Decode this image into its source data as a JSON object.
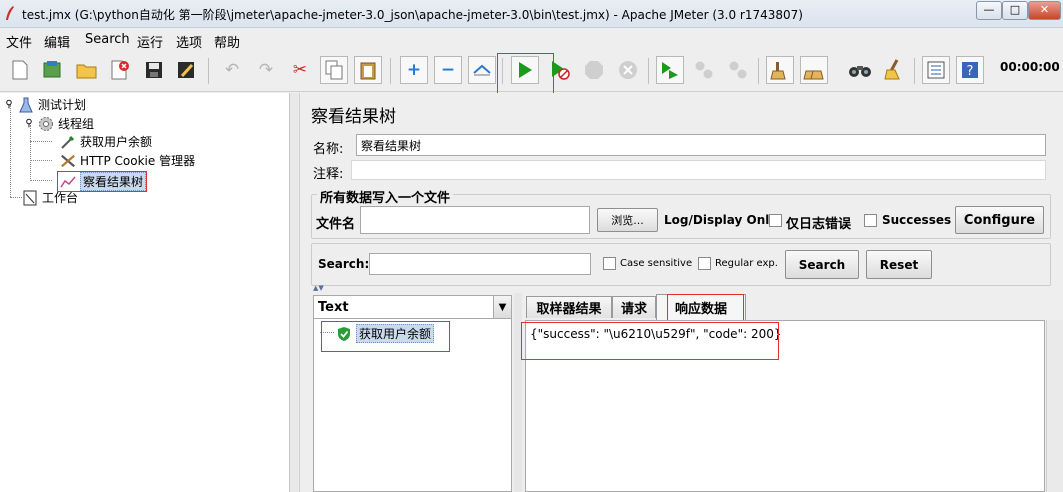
{
  "window": {
    "title": "test.jmx (G:\\python自动化 第一阶段\\jmeter\\apache-jmeter-3.0_json\\apache-jmeter-3.0\\bin\\test.jmx) - Apache JMeter (3.0 r1743807)",
    "min_glyph": "—",
    "max_glyph": "□",
    "close_glyph": "✕"
  },
  "menu": {
    "items": [
      {
        "label": "文件"
      },
      {
        "label": "编辑"
      },
      {
        "label": "Search"
      },
      {
        "label": "运行"
      },
      {
        "label": "选项"
      },
      {
        "label": "帮助"
      }
    ]
  },
  "toolbar": {
    "timer": "00:00:00",
    "icons": [
      "new-icon",
      "templates-icon",
      "open-icon",
      "close-file-icon",
      "save-icon",
      "save-as-icon",
      "undo-icon",
      "redo-icon",
      "cut-icon",
      "copy-icon",
      "paste-icon",
      "expand-icon",
      "collapse-icon",
      "toggle-icon",
      "start-icon",
      "start-no-timers-icon",
      "stop-icon",
      "shutdown-icon",
      "remote-start-icon",
      "remote-stop-icon",
      "remote-shutdown-icon",
      "clear-icon",
      "clear-all-icon",
      "search-icon",
      "reset-search-icon",
      "function-helper-icon",
      "help-icon"
    ]
  },
  "tree": {
    "nodes": [
      {
        "label": "测试计划",
        "icon": "flask-icon"
      },
      {
        "label": "线程组",
        "icon": "gear-icon"
      },
      {
        "label": "获取用户余额",
        "icon": "pipette-icon"
      },
      {
        "label": "HTTP Cookie 管理器",
        "icon": "tools-icon"
      },
      {
        "label": "察看结果树",
        "icon": "graph-icon",
        "selected": true
      },
      {
        "label": "工作台",
        "icon": "workbench-icon"
      }
    ]
  },
  "panel": {
    "title": "察看结果树",
    "name_label": "名称:",
    "name_value": "察看结果树",
    "comment_label": "注释:",
    "comment_value": "",
    "write_group_title": "所有数据写入一个文件",
    "filename_label": "文件名",
    "filename_value": "",
    "browse_label": "浏览...",
    "log_display_label": "Log/Display Only:",
    "errors_only_label": "仅日志错误",
    "errors_only_checked": false,
    "successes_label": "Successes",
    "successes_checked": false,
    "configure_label": "Configure",
    "search_label": "Search:",
    "search_value": "",
    "case_sensitive_label": "Case sensitive",
    "case_sensitive_checked": false,
    "regex_label": "Regular exp.",
    "regex_checked": false,
    "search_button": "Search",
    "reset_button": "Reset"
  },
  "results": {
    "renderer": "Text",
    "samples": [
      {
        "label": "获取用户余额",
        "status": "success"
      }
    ],
    "tabs": [
      {
        "label": "取样器结果"
      },
      {
        "label": "请求"
      },
      {
        "label": "响应数据",
        "active": true
      }
    ],
    "response_data": "{\"success\": \"\\u6210\\u529f\", \"code\": 200}"
  },
  "colors": {
    "highlight": "#e03030",
    "start": "#1c9a1c",
    "selection": "#c9d9ee"
  }
}
